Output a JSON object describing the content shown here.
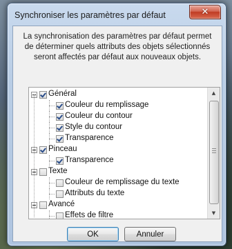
{
  "window": {
    "title": "Synchroniser les paramètres par défaut"
  },
  "description": "La synchronisation des paramètres par défaut permet de déterminer quels attributs des objets sélectionnés seront affectés par défaut aux nouveaux objets.",
  "tree": [
    {
      "label": "Général",
      "level": 0,
      "checked": true,
      "expanded": true
    },
    {
      "label": "Couleur du remplissage",
      "level": 1,
      "checked": true
    },
    {
      "label": "Couleur du contour",
      "level": 1,
      "checked": true
    },
    {
      "label": "Style du contour",
      "level": 1,
      "checked": true
    },
    {
      "label": "Transparence",
      "level": 1,
      "checked": true
    },
    {
      "label": "Pinceau",
      "level": 0,
      "checked": true,
      "expanded": true
    },
    {
      "label": "Transparence",
      "level": 1,
      "checked": true
    },
    {
      "label": "Texte",
      "level": 0,
      "checked": false,
      "expanded": true
    },
    {
      "label": "Couleur de remplissage du texte",
      "level": 1,
      "checked": false
    },
    {
      "label": "Attributs du texte",
      "level": 1,
      "checked": false
    },
    {
      "label": "Avancé",
      "level": 0,
      "checked": false,
      "expanded": true
    },
    {
      "label": "Effets de filtre",
      "level": 1,
      "checked": false
    }
  ],
  "buttons": {
    "ok": "OK",
    "cancel": "Annuler"
  },
  "icons": {
    "close": "close-icon",
    "scroll_up": "scroll-up-arrow-icon",
    "scroll_down": "scroll-down-arrow-icon"
  }
}
